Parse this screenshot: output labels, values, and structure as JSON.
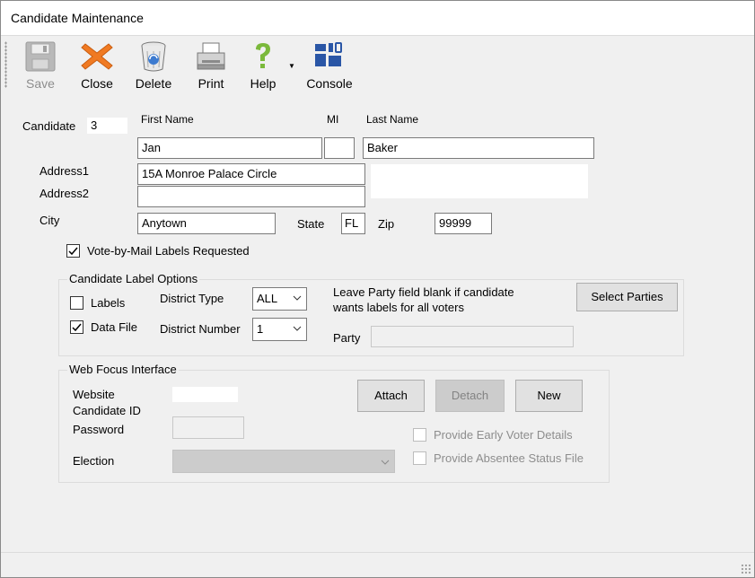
{
  "window": {
    "title": "Candidate Maintenance"
  },
  "toolbar": {
    "save": "Save",
    "close": "Close",
    "delete": "Delete",
    "print": "Print",
    "help": "Help",
    "help_dropdown": "▼",
    "console": "Console"
  },
  "candidate": {
    "id_label": "Candidate",
    "id_value": "3",
    "first_name_label": "First Name",
    "mi_label": "MI",
    "last_name_label": "Last Name",
    "first_name": "Jan",
    "mi": "",
    "last_name": "Baker",
    "address1_label": "Address1",
    "address1": "15A Monroe Palace Circle",
    "address2_label": "Address2",
    "address2": "",
    "address_note": "",
    "city_label": "City",
    "city": "Anytown",
    "state_label": "State",
    "state": "FL",
    "zip_label": "Zip",
    "zip": "99999",
    "vbm_label": "Vote-by-Mail Labels Requested",
    "vbm_checked": true
  },
  "label_options": {
    "legend": "Candidate Label Options",
    "labels_label": "Labels",
    "labels_checked": false,
    "datafile_label": "Data File",
    "datafile_checked": true,
    "district_type_label": "District Type",
    "district_type": "ALL",
    "district_number_label": "District Number",
    "district_number": "1",
    "note_line1": "Leave Party field blank if candidate",
    "note_line2": "wants labels for all voters",
    "select_parties": "Select Parties",
    "party_label": "Party",
    "party": ""
  },
  "web_focus": {
    "legend": "Web Focus Interface",
    "website_label": "Website",
    "candidate_id_label": "Candidate ID",
    "website_candidate_id": "",
    "password_label": "Password",
    "password": "",
    "election_label": "Election",
    "election": "",
    "attach": "Attach",
    "detach": "Detach",
    "new": "New",
    "early_voter": "Provide Early Voter Details",
    "early_voter_checked": false,
    "absentee": "Provide Absentee Status File",
    "absentee_checked": false
  },
  "colors": {
    "close_x": "#f07a22",
    "help_q": "#7bb93b",
    "console_blue": "#2a56a6",
    "window_bg": "#f0f0f0"
  }
}
